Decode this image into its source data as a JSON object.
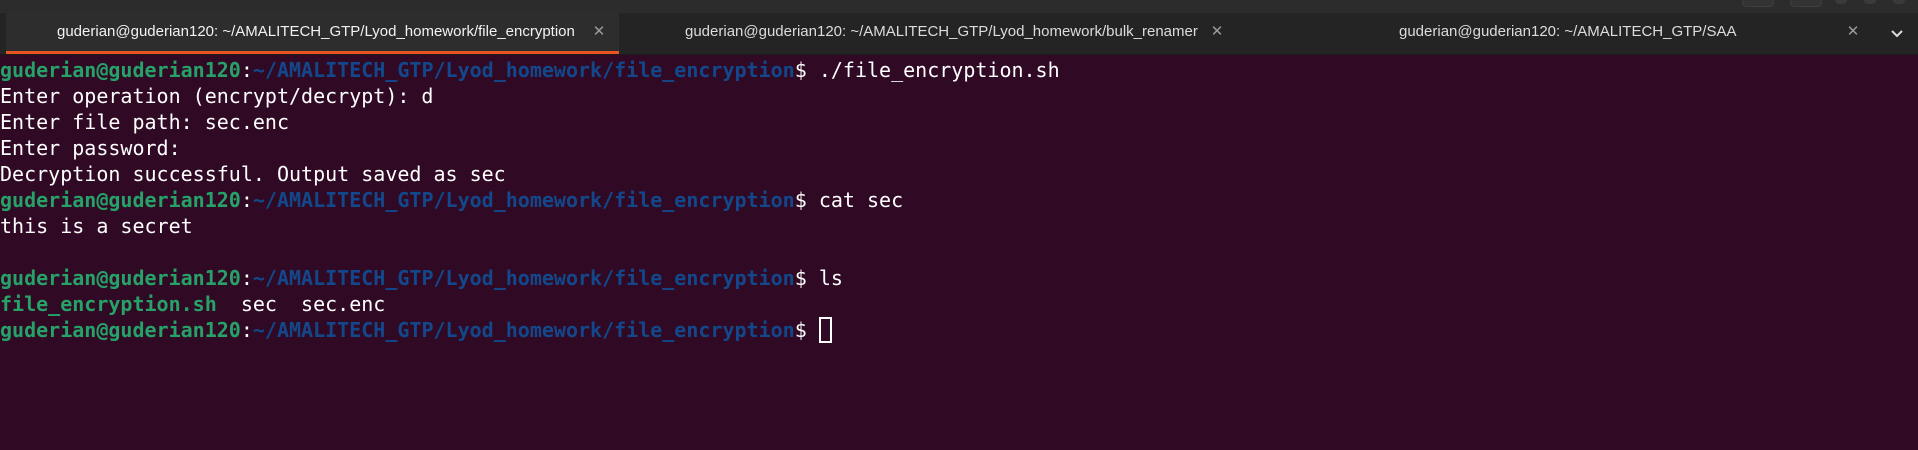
{
  "tabs": [
    {
      "title": "guderian@guderian120: ~/AMALITECH_GTP/Lyod_homework/file_encryption",
      "active": true
    },
    {
      "title": "guderian@guderian120: ~/AMALITECH_GTP/Lyod_homework/bulk_renamer",
      "active": false
    },
    {
      "title": "guderian@guderian120: ~/AMALITECH_GTP/SAA",
      "active": false
    }
  ],
  "prompt": {
    "user_host": "guderian@guderian120",
    "separator": ":",
    "path": "~/AMALITECH_GTP/Lyod_homework/file_encryption",
    "symbol": "$"
  },
  "session": {
    "cmd1": " ./file_encryption.sh",
    "out_operation": "Enter operation (encrypt/decrypt): d",
    "out_filepath": "Enter file path: sec.enc",
    "out_password": "Enter password:",
    "out_success": "Decryption successful. Output saved as sec",
    "cmd2": " cat sec",
    "out_secret": "this is a secret",
    "cmd3": " ls",
    "ls_exec": "file_encryption.sh",
    "ls_files": "  sec  sec.enc"
  },
  "colors": {
    "background": "#300a24",
    "prompt_user": "#26a269",
    "prompt_path": "#12488b",
    "tab_accent": "#e95420"
  }
}
